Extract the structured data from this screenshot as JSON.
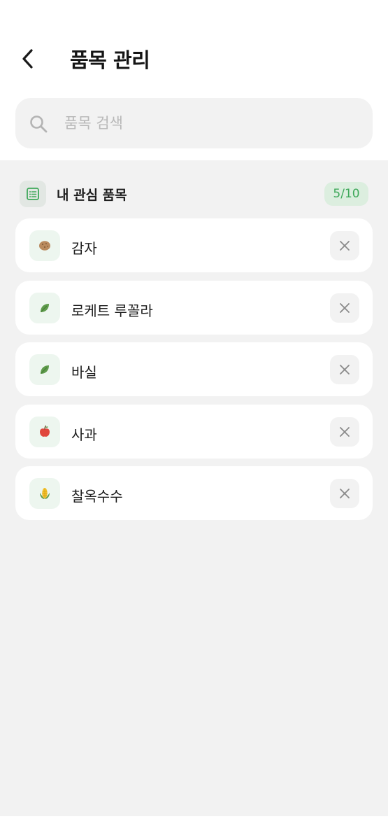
{
  "header": {
    "title": "품목 관리"
  },
  "search": {
    "placeholder": "품목 검색",
    "value": ""
  },
  "section": {
    "title": "내 관심 품목",
    "count": "5/10"
  },
  "items": [
    {
      "label": "감자",
      "icon": "potato-icon"
    },
    {
      "label": "로케트 루꼴라",
      "icon": "leaf-icon"
    },
    {
      "label": "바실",
      "icon": "leaf-icon"
    },
    {
      "label": "사과",
      "icon": "apple-icon"
    },
    {
      "label": "찰옥수수",
      "icon": "corn-icon"
    }
  ],
  "colors": {
    "accent": "#3ea85a",
    "badge_bg": "#dceedf",
    "background": "#f2f2f2",
    "card": "#ffffff"
  }
}
